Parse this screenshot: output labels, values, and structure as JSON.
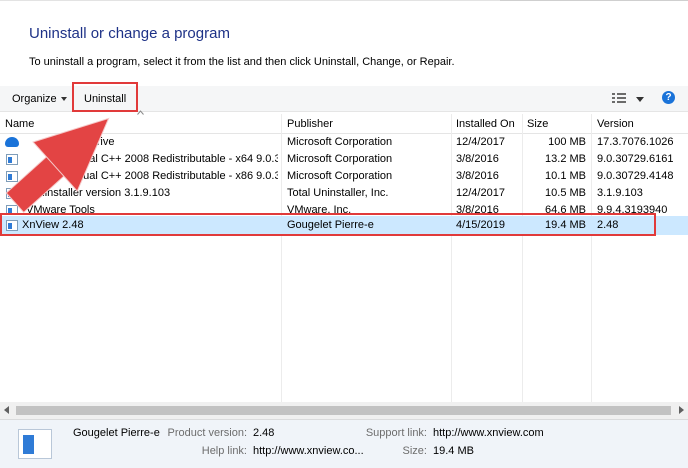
{
  "header": {
    "title": "Uninstall or change a program",
    "subtitle": "To uninstall a program, select it from the list and then click Uninstall, Change, or Repair."
  },
  "toolbar": {
    "organize_label": "Organize",
    "uninstall_label": "Uninstall",
    "help_label": "?"
  },
  "columns": [
    "Name",
    "Publisher",
    "Installed On",
    "Size",
    "Version"
  ],
  "rows": [
    {
      "name": "OneDrive",
      "publisher": "Microsoft Corporation",
      "installed": "12/4/2017",
      "size": "100 MB",
      "version": "17.3.7076.1026",
      "icon": "onedrive-icon"
    },
    {
      "name": "Visual C++ 2008 Redistributable - x64 9.0.3...",
      "publisher": "Microsoft Corporation",
      "installed": "3/8/2016",
      "size": "13.2 MB",
      "version": "9.0.30729.6161",
      "icon": "program-icon"
    },
    {
      "name": "Visual C++ 2008 Redistributable - x86 9.0.3...",
      "publisher": "Microsoft Corporation",
      "installed": "3/8/2016",
      "size": "10.1 MB",
      "version": "9.0.30729.4148",
      "icon": "program-icon"
    },
    {
      "name": "tal Uninstaller version 3.1.9.103",
      "publisher": "Total Uninstaller, Inc.",
      "installed": "12/4/2017",
      "size": "10.5 MB",
      "version": "3.1.9.103",
      "icon": "program-icon"
    },
    {
      "name": "VMware Tools",
      "publisher": "VMware, Inc.",
      "installed": "3/8/2016",
      "size": "64.6 MB",
      "version": "9.9.4.3193940",
      "icon": "program-icon"
    },
    {
      "name": "XnView 2.48",
      "publisher": "Gougelet Pierre-e",
      "installed": "4/15/2019",
      "size": "19.4 MB",
      "version": "2.48",
      "icon": "program-icon",
      "selected": true
    }
  ],
  "details": {
    "name": "Gougelet Pierre-e",
    "product_version_label": "Product version:",
    "product_version": "2.48",
    "help_link_label": "Help link:",
    "help_link": "http://www.xnview.co...",
    "support_link_label": "Support link:",
    "support_link": "http://www.xnview.com",
    "size_label": "Size:",
    "size": "19.4 MB"
  },
  "colors": {
    "title": "#1e3287",
    "highlight": "#e13a3a",
    "selection": "#cce8ff"
  }
}
